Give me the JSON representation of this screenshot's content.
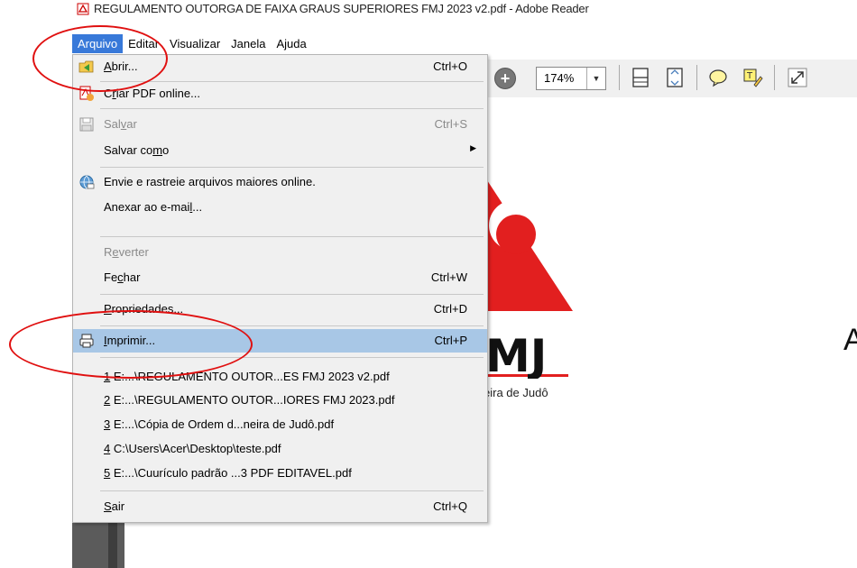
{
  "window": {
    "title": "REGULAMENTO OUTORGA DE FAIXA GRAUS SUPERIORES FMJ 2023 v2.pdf - Adobe Reader"
  },
  "menubar": {
    "items": [
      "Arquivo",
      "Editar",
      "Visualizar",
      "Janela",
      "Ajuda"
    ],
    "active": "Arquivo"
  },
  "toolbar": {
    "zoom": "174%"
  },
  "file_menu": {
    "abrir": {
      "pre": "",
      "u": "A",
      "post": "brir...",
      "shortcut": "Ctrl+O"
    },
    "criar": {
      "pre": "C",
      "u": "r",
      "post": "iar PDF online..."
    },
    "salvar": {
      "pre": "Sal",
      "u": "v",
      "post": "ar",
      "shortcut": "Ctrl+S"
    },
    "salvar_como": {
      "pre": "Salvar co",
      "u": "m",
      "post": "o"
    },
    "envie": {
      "label": "Envie e rastreie arquivos maiores online."
    },
    "anexar": {
      "pre": "Anexar ao e-mai",
      "u": "l",
      "post": "..."
    },
    "reverter": {
      "pre": "R",
      "u": "e",
      "post": "verter"
    },
    "fechar": {
      "pre": "Fe",
      "u": "c",
      "post": "har",
      "shortcut": "Ctrl+W"
    },
    "propriedades": {
      "pre": "",
      "u": "P",
      "post": "ropriedades...",
      "shortcut": "Ctrl+D"
    },
    "imprimir": {
      "pre": "",
      "u": "I",
      "post": "mprimir...",
      "shortcut": "Ctrl+P"
    },
    "recent": [
      {
        "num": "1",
        "path": " E:...\\REGULAMENTO OUTOR...ES FMJ 2023 v2.pdf"
      },
      {
        "num": "2",
        "path": " E:...\\REGULAMENTO OUTOR...IORES FMJ 2023.pdf"
      },
      {
        "num": "3",
        "path": " E:...\\Cópia de Ordem d...neira de Judô.pdf"
      },
      {
        "num": "4",
        "path": " C:\\Users\\Acer\\Desktop\\teste.pdf"
      },
      {
        "num": "5",
        "path": " E:...\\Cuurículo padrão ...3 PDF EDITAVEL.pdf"
      }
    ],
    "sair": {
      "pre": "",
      "u": "S",
      "post": "air",
      "shortcut": "Ctrl+Q"
    }
  },
  "document": {
    "logo_text": "MJ",
    "caption": "eira de Judô",
    "right_letter": "A"
  },
  "colors": {
    "menu_active": "#3879d9",
    "highlight": "#a8c7e6",
    "annotation": "#e01010",
    "logo_red": "#e21f1f"
  }
}
